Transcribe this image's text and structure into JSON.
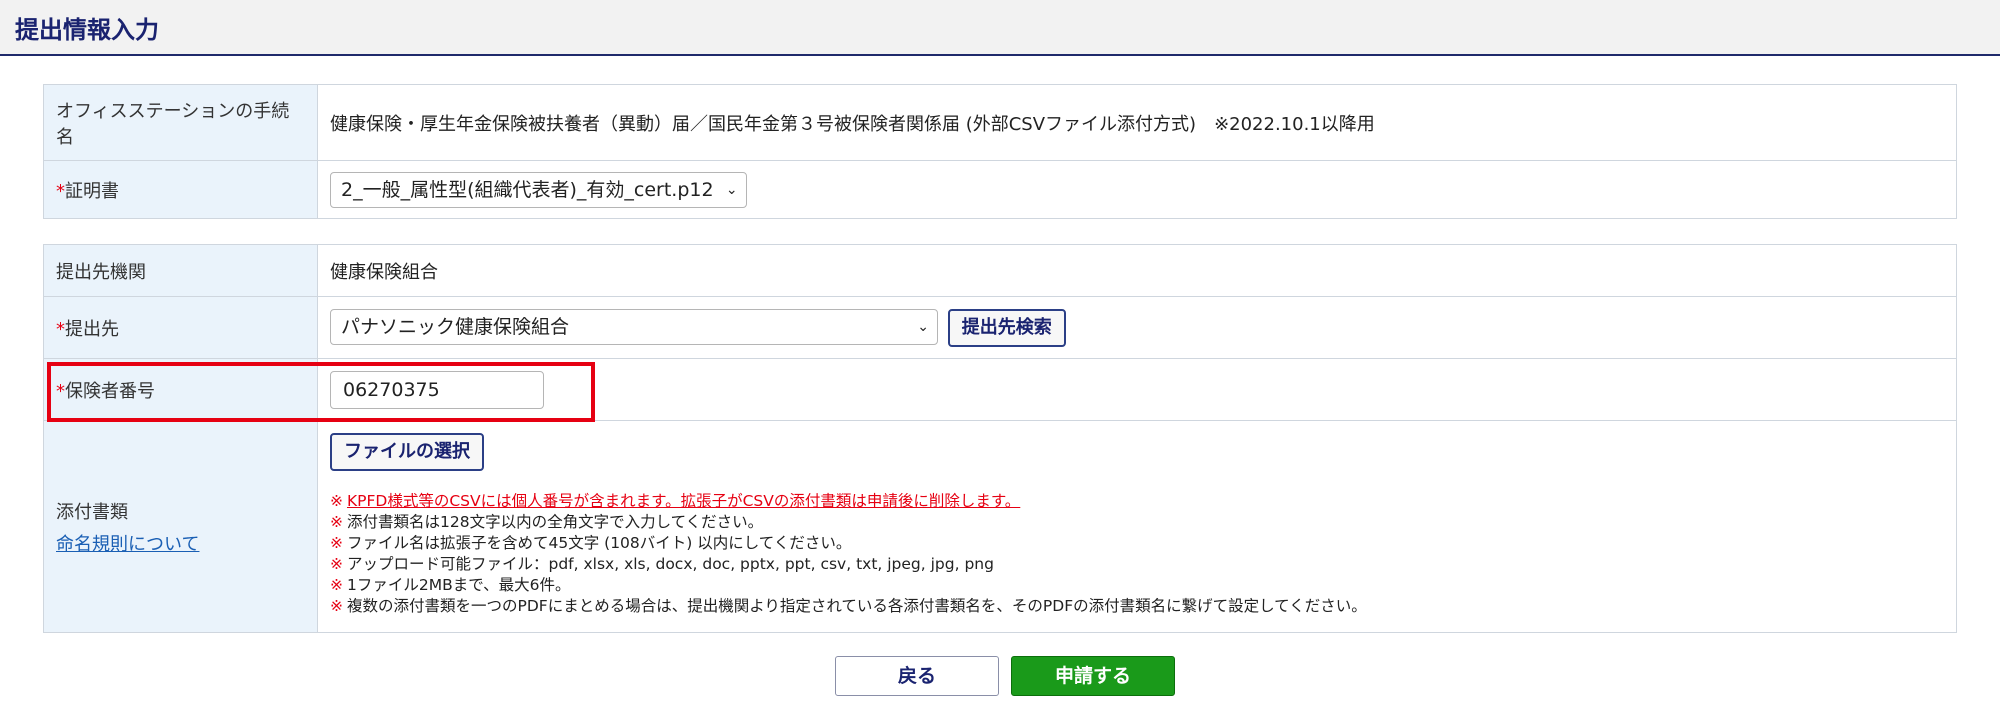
{
  "header": {
    "title": "提出情報入力"
  },
  "office": {
    "label": "オフィスステーションの手続名",
    "value": "健康保険・厚生年金保険被扶養者（異動）届／国民年金第３号被保険者関係届 (外部CSVファイル添付方式)　※2022.10.1以降用"
  },
  "certificate": {
    "required_mark": "*",
    "label": "証明書",
    "selected": "2_一般_属性型(組織代表者)_有効_cert.p12"
  },
  "organization": {
    "label": "提出先機関",
    "value": "健康保険組合"
  },
  "destination": {
    "required_mark": "*",
    "label": "提出先",
    "selected": "パナソニック健康保険組合",
    "search_button": "提出先検索"
  },
  "insurer": {
    "required_mark": "*",
    "label": "保険者番号",
    "value": "06270375"
  },
  "attachments": {
    "label": "添付書類",
    "link": "命名規則について",
    "file_button": "ファイルの選択",
    "mark": "※",
    "notes": [
      "KPFD様式等のCSVには個人番号が含まれます。拡張子がCSVの添付書類は申請後に削除します。",
      "添付書類名は128文字以内の全角文字で入力してください。",
      "ファイル名は拡張子を含めて45文字 (108バイト) 以内にしてください。",
      "アップロード可能ファイル：pdf, xlsx, xls, docx, doc, pptx, ppt, csv, txt, jpeg, jpg, png",
      "1ファイル2MBまで、最大6件。",
      "複数の添付書類を一つのPDFにまとめる場合は、提出機関より指定されている各添付書類名を、そのPDFの添付書類名に繋げて設定してください。"
    ]
  },
  "footer": {
    "back_label": "戻る",
    "apply_label": "申請する"
  },
  "colors": {
    "accent": "#1a2370",
    "required": "#e60012",
    "primary_button": "#1a9a1a",
    "label_bg": "#eaf3fb"
  }
}
